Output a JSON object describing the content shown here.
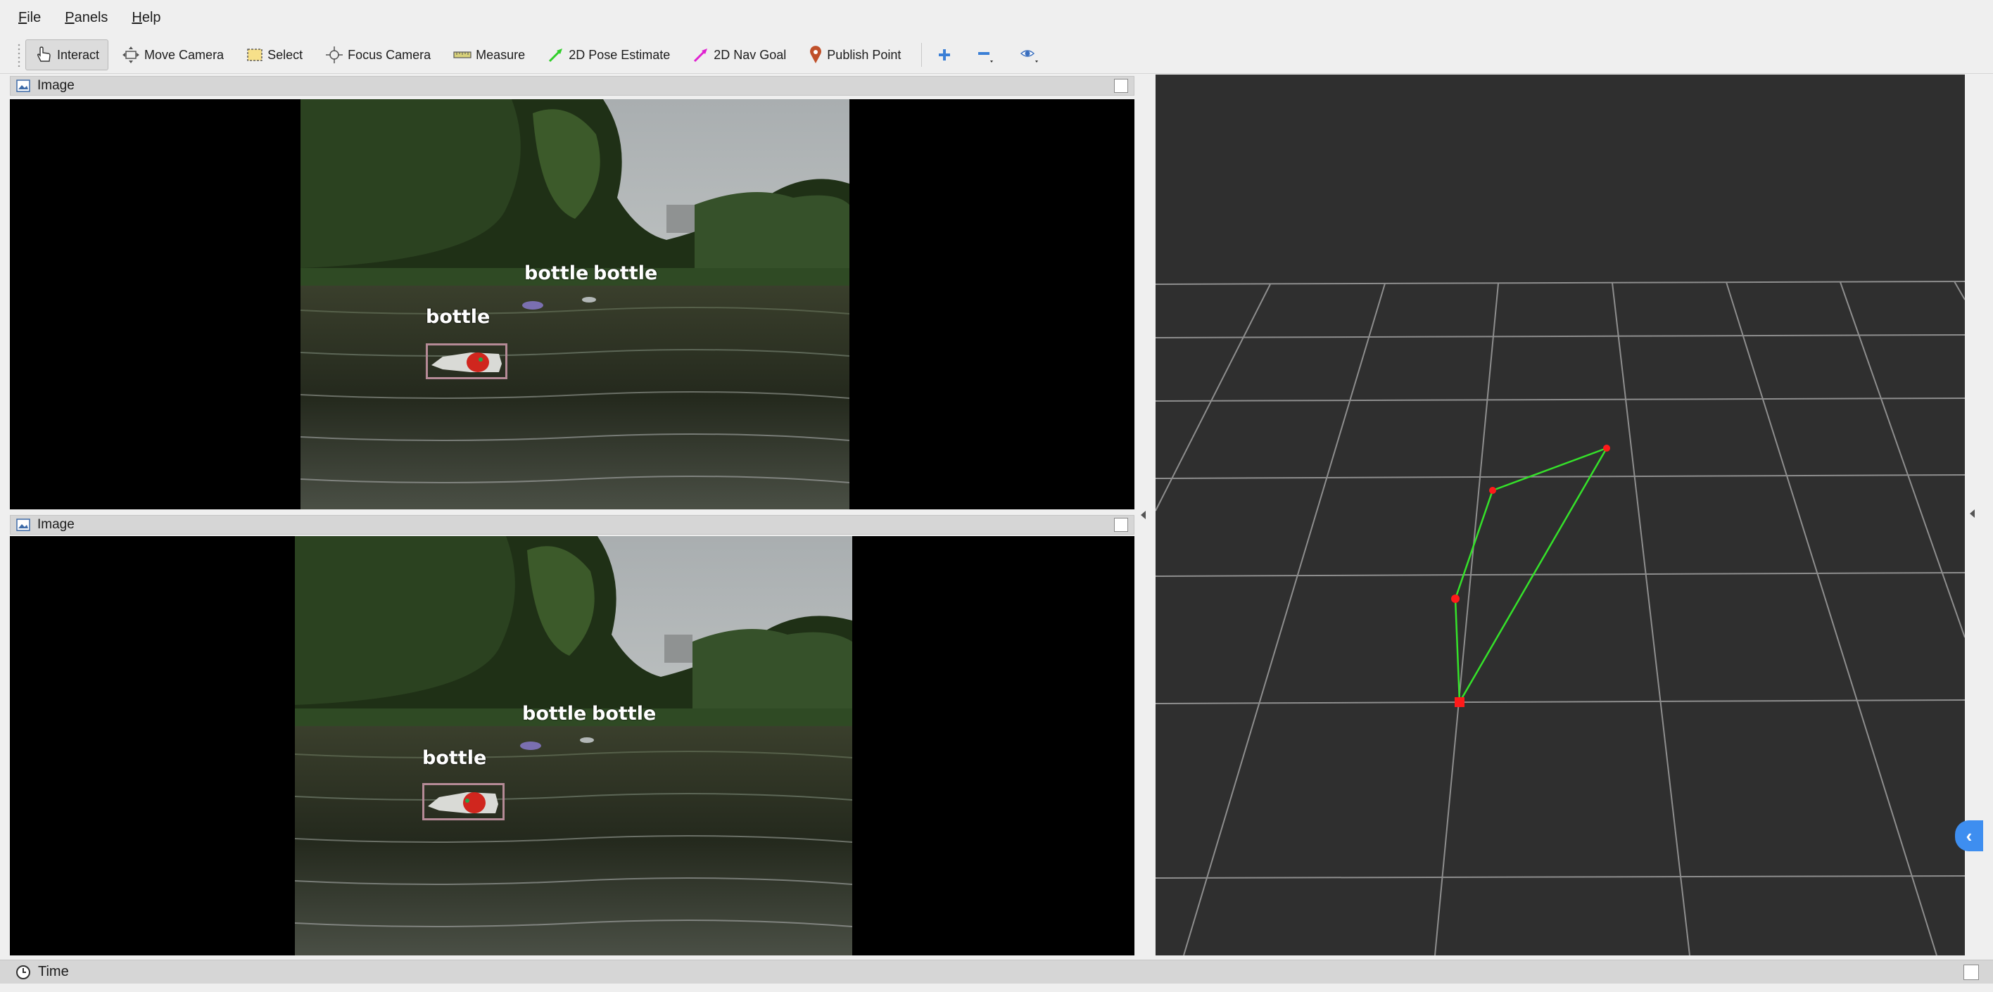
{
  "menu": {
    "file": {
      "mnemonic": "F",
      "rest": "ile"
    },
    "panels": {
      "mnemonic": "P",
      "rest": "anels"
    },
    "help": {
      "mnemonic": "H",
      "rest": "elp"
    }
  },
  "toolbar": {
    "interact": "Interact",
    "move_camera": "Move Camera",
    "select": "Select",
    "focus_camera": "Focus Camera",
    "measure": "Measure",
    "pose_estimate": "2D Pose Estimate",
    "nav_goal": "2D Nav Goal",
    "publish_point": "Publish Point"
  },
  "panels": {
    "top_image_title": "Image",
    "bottom_image_title": "Image",
    "time_title": "Time"
  },
  "detections_top": [
    "bottle",
    "bottle",
    "bottle"
  ],
  "detections_bottom": [
    "bottle",
    "bottle",
    "bottle"
  ],
  "colors": {
    "path_line": "#35e22a",
    "path_point": "#ff1a1a",
    "grid": "#9a9a9a",
    "collapse_button": "#3e8ef0"
  }
}
